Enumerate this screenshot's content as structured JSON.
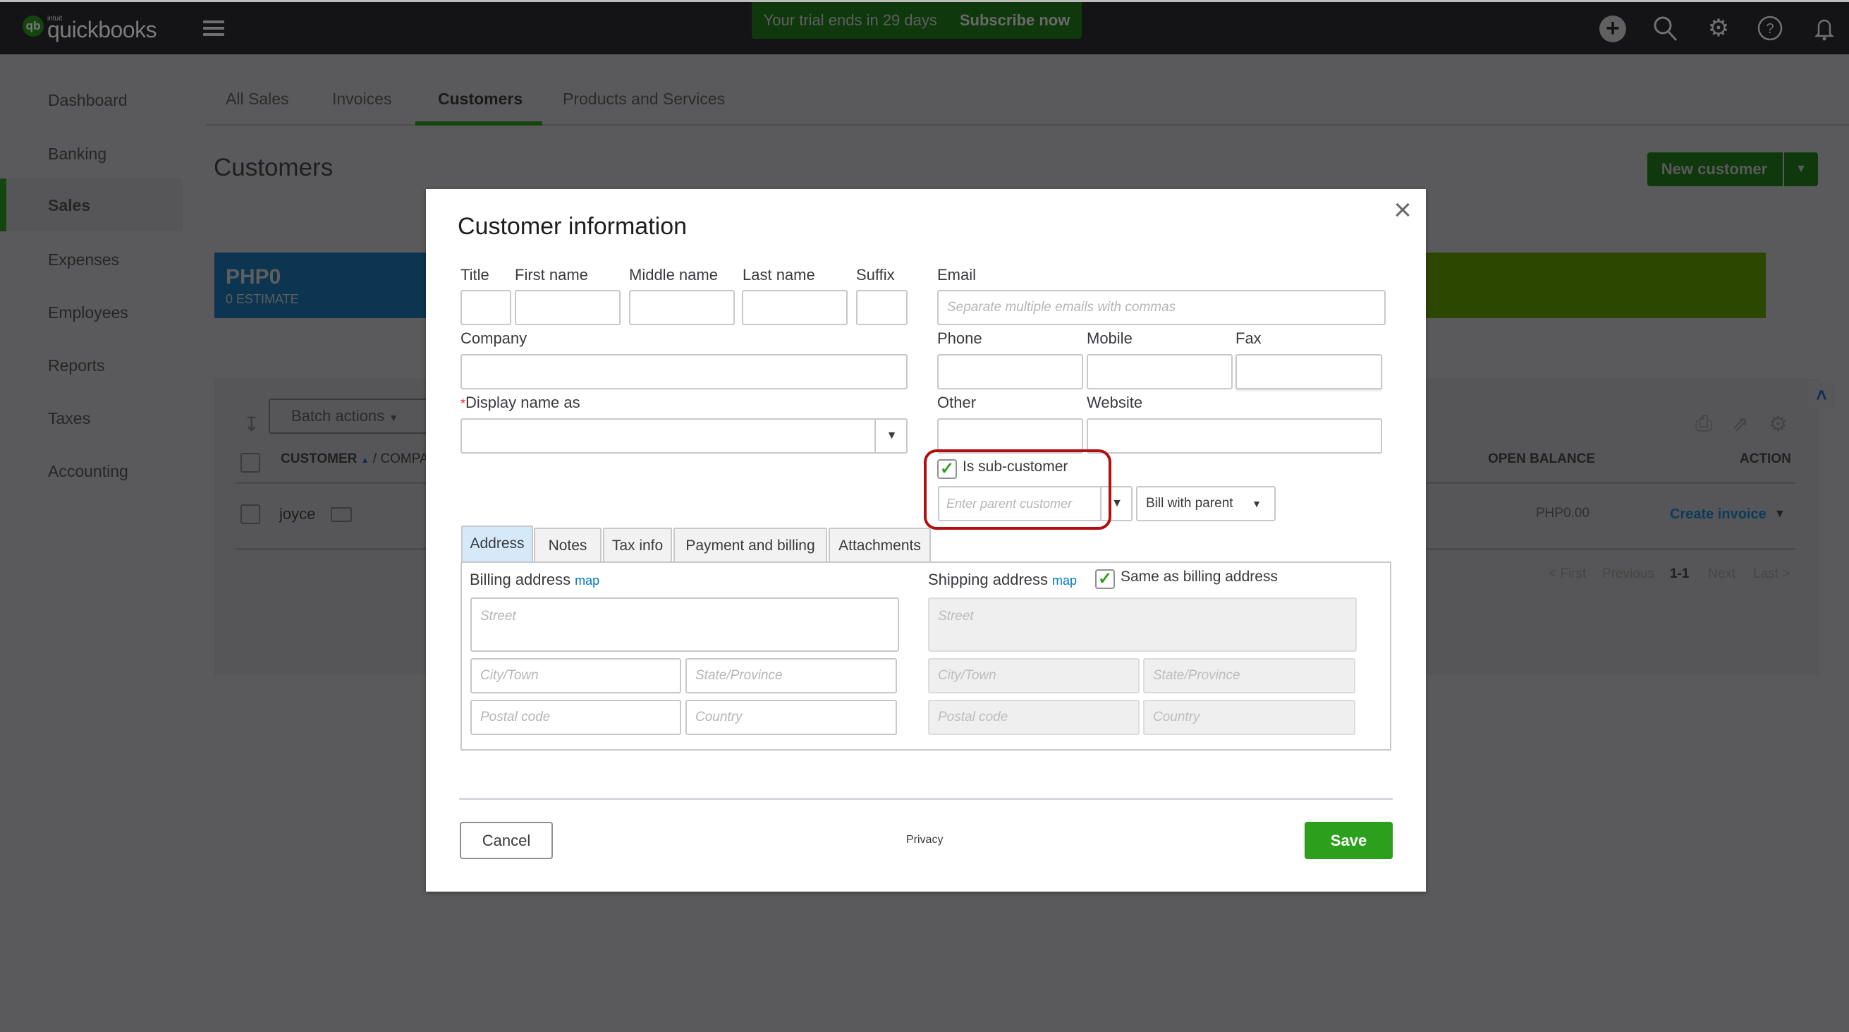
{
  "topbar": {
    "logo_mark": "qb",
    "logo_brand": "intuit",
    "logo_name": "quickbooks",
    "trial_text": "Your trial ends in 29 days",
    "subscribe_label": "Subscribe now",
    "icons": [
      "plus-icon",
      "search-icon",
      "gear-icon",
      "help-icon",
      "bell-icon"
    ]
  },
  "sidebar": {
    "items": [
      {
        "label": "Dashboard"
      },
      {
        "label": "Banking"
      },
      {
        "label": "Sales",
        "active": true
      },
      {
        "label": "Expenses"
      },
      {
        "label": "Employees"
      },
      {
        "label": "Reports"
      },
      {
        "label": "Taxes"
      },
      {
        "label": "Accounting"
      }
    ]
  },
  "subtabs": {
    "items": [
      {
        "label": "All Sales"
      },
      {
        "label": "Invoices"
      },
      {
        "label": "Customers",
        "active": true
      },
      {
        "label": "Products and Services"
      }
    ]
  },
  "page": {
    "title": "Customers",
    "new_customer_label": "New customer",
    "money_bar": {
      "amount": "PHP0",
      "caption": "0 ESTIMATE"
    },
    "batch_actions_label": "Batch actions",
    "table": {
      "columns": {
        "customer": "CUSTOMER",
        "company_partial": "/ COMPA",
        "open_balance": "OPEN BALANCE",
        "action": "ACTION"
      },
      "rows": [
        {
          "customer": "joyce",
          "open_balance": "PHP0.00",
          "action": "Create invoice"
        }
      ]
    },
    "pager": {
      "first": "< First",
      "previous": "Previous",
      "range": "1-1",
      "next": "Next",
      "last": "Last >"
    }
  },
  "modal": {
    "title": "Customer information",
    "labels": {
      "title": "Title",
      "first_name": "First name",
      "middle_name": "Middle name",
      "last_name": "Last name",
      "suffix": "Suffix",
      "email": "Email",
      "company": "Company",
      "phone": "Phone",
      "mobile": "Mobile",
      "fax": "Fax",
      "display_name": "Display name as",
      "required_mark": "*",
      "other": "Other",
      "website": "Website"
    },
    "email_placeholder": "Separate multiple emails with commas",
    "values": {
      "title": "",
      "first_name": "",
      "middle_name": "",
      "last_name": "",
      "suffix": "",
      "email": "",
      "company": "",
      "phone": "",
      "mobile": "",
      "fax": "",
      "display_name": "",
      "other": "",
      "website": "",
      "parent_customer": ""
    },
    "sub_customer": {
      "checkbox_label": "Is sub-customer",
      "checked": true,
      "parent_placeholder": "Enter parent customer",
      "billing_option": "Bill with parent"
    },
    "tabs": [
      {
        "label": "Address",
        "active": true
      },
      {
        "label": "Notes"
      },
      {
        "label": "Tax info"
      },
      {
        "label": "Payment and billing"
      },
      {
        "label": "Attachments"
      }
    ],
    "billing": {
      "heading": "Billing address",
      "map_link": "map",
      "street_placeholder": "Street",
      "city_placeholder": "City/Town",
      "state_placeholder": "State/Province",
      "postal_placeholder": "Postal code",
      "country_placeholder": "Country"
    },
    "shipping": {
      "heading": "Shipping address",
      "map_link": "map",
      "same_as_billing_label": "Same as billing address",
      "same_as_billing_checked": true,
      "street_placeholder": "Street",
      "city_placeholder": "City/Town",
      "state_placeholder": "State/Province",
      "postal_placeholder": "Postal code",
      "country_placeholder": "Country"
    },
    "footer": {
      "cancel_label": "Cancel",
      "privacy_label": "Privacy",
      "save_label": "Save"
    }
  },
  "colors": {
    "brand_green": "#2ca01c",
    "link_blue": "#0077c5",
    "highlight_red": "#b30f10",
    "active_tab_bg": "#d5e9f9"
  }
}
